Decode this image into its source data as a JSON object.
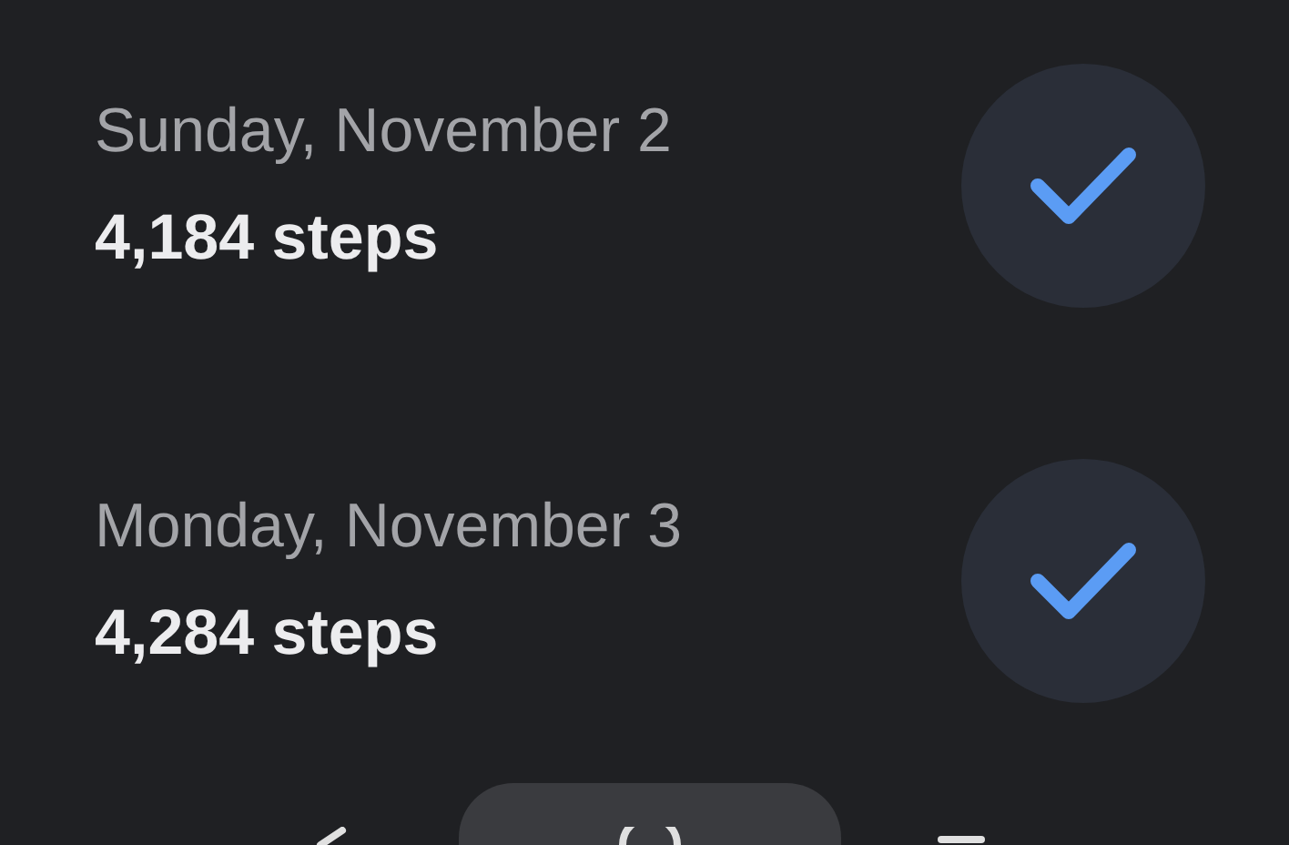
{
  "entries": [
    {
      "date": "Sunday, November 2",
      "steps": "4,184 steps",
      "done": true
    },
    {
      "date": "Monday, November 3",
      "steps": "4,284 steps",
      "done": true
    }
  ]
}
